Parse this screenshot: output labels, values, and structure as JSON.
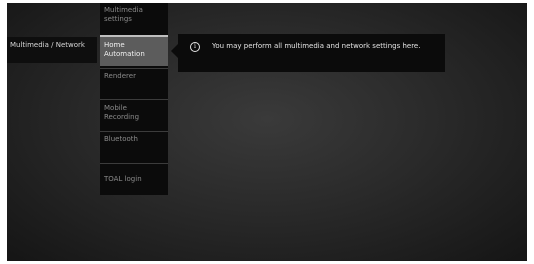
{
  "left": {
    "label": "Multimedia / Network"
  },
  "menu": {
    "items": [
      {
        "label": "Multimedia settings"
      },
      {
        "label": "Home Automation"
      },
      {
        "label": "Renderer"
      },
      {
        "label": "Mobile Recording"
      },
      {
        "label": "Bluetooth"
      },
      {
        "label": "TOAL login"
      }
    ]
  },
  "info": {
    "icon": "info-icon",
    "text": "You may perform all multimedia and network settings here."
  }
}
